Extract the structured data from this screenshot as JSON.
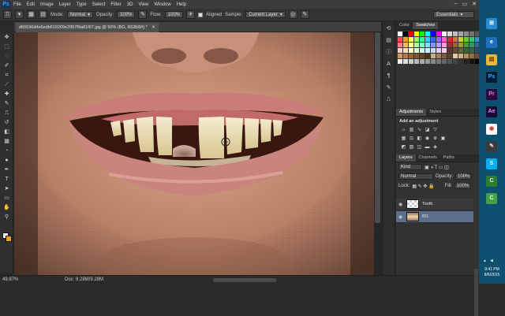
{
  "menubar": {
    "logo": "Ps",
    "items": [
      "File",
      "Edit",
      "Image",
      "Layer",
      "Type",
      "Select",
      "Filter",
      "3D",
      "View",
      "Window",
      "Help"
    ],
    "window_controls": [
      "–",
      "▭",
      "✕"
    ]
  },
  "options": {
    "mode_label": "Mode:",
    "mode_value": "Normal",
    "opacity_label": "Opacity:",
    "opacity_value": "100%",
    "flow_label": "Flow:",
    "flow_value": "100%",
    "aligned_label": "Aligned",
    "sample_label": "Sample:",
    "sample_value": "Current Layer",
    "workspace_value": "Essentials"
  },
  "document": {
    "tab_title": "d65596d4e6edb519209e2957f9a81f67.jpg @ 50% (BG, RGB/8#) *",
    "close": "✕"
  },
  "status": {
    "zoom": "49.87%",
    "doc_info": "Doc: 9.28M/9.28M"
  },
  "panels": {
    "color_tab": "Color",
    "swatches_tab": "Swatches",
    "adjustments_tab": "Adjustments",
    "styles_tab": "Styles",
    "add_adjustment": "Add an adjustment",
    "layers_tab": "Layers",
    "channels_tab": "Channels",
    "paths_tab": "Paths",
    "kind_value": "Kind",
    "blend_value": "Normal",
    "opacity_label": "Opacity:",
    "opacity_value": "100%",
    "lock_label": "Lock:",
    "fill_label": "Fill:",
    "fill_value": "100%",
    "layers": [
      {
        "name": "Tooth"
      },
      {
        "name": "BG"
      }
    ]
  },
  "swatch_colors": [
    "#ffffff",
    "#000000",
    "#ff0000",
    "#ffff00",
    "#00ff00",
    "#00ffff",
    "#0000ff",
    "#ff00ff",
    "#f2f2f2",
    "#d9d9d9",
    "#bfbfbf",
    "#a6a6a6",
    "#8c8c8c",
    "#737373",
    "#595959",
    "#ff4d4d",
    "#ff9933",
    "#ffff66",
    "#99ff66",
    "#33ff99",
    "#33ccff",
    "#3366ff",
    "#9966ff",
    "#ff66cc",
    "#cc3333",
    "#cc7a29",
    "#cccc33",
    "#66cc33",
    "#29cc7a",
    "#2999cc",
    "#ff8080",
    "#ffb366",
    "#ffff99",
    "#b3ff99",
    "#80ffbf",
    "#80dfff",
    "#8099ff",
    "#b399ff",
    "#ff99dd",
    "#993333",
    "#996633",
    "#999933",
    "#4d9933",
    "#339966",
    "#336699",
    "#ffcccc",
    "#ffe0b3",
    "#ffffcc",
    "#d9ffcc",
    "#ccffe6",
    "#ccf2ff",
    "#ccd6ff",
    "#e0ccff",
    "#ffccee",
    "#663333",
    "#664d33",
    "#666633",
    "#336633",
    "#33664d",
    "#334d66",
    "#cc9966",
    "#b37a4d",
    "#996633",
    "#805533",
    "#664422",
    "#4d3319",
    "#c8b08a",
    "#a08060",
    "#7a5c40",
    "#5a4030",
    "#e0c8a0",
    "#d0b080",
    "#b09060",
    "#907040",
    "#705030",
    "#eeeeee",
    "#dddddd",
    "#cccccc",
    "#bbbbbb",
    "#aaaaaa",
    "#999999",
    "#888888",
    "#777777",
    "#666666",
    "#555555",
    "#444444",
    "#333333",
    "#222222",
    "#111111",
    "#000000"
  ],
  "taskbar": {
    "time": "9:41 PM",
    "date": "8/6/2015",
    "apps": [
      {
        "label": "⊞",
        "bg": "#2b8ad6",
        "fg": "#ffffff"
      },
      {
        "label": "e",
        "bg": "#1e6fbf",
        "fg": "#ffffff"
      },
      {
        "label": "▤",
        "bg": "#e8b93a",
        "fg": "#5a3a00"
      },
      {
        "label": "Ps",
        "bg": "#001d34",
        "fg": "#31a8ff"
      },
      {
        "label": "Pr",
        "bg": "#2a0a3a",
        "fg": "#ea77ff"
      },
      {
        "label": "Ae",
        "bg": "#1a0a33",
        "fg": "#d291ff"
      },
      {
        "label": "◉",
        "bg": "#ffffff",
        "fg": "#d93025"
      },
      {
        "label": "✎",
        "bg": "#3a3a3a",
        "fg": "#dddddd"
      },
      {
        "label": "S",
        "bg": "#00aff0",
        "fg": "#ffffff"
      },
      {
        "label": "C",
        "bg": "#2e7d32",
        "fg": "#ffffff"
      },
      {
        "label": "C",
        "bg": "#43a047",
        "fg": "#ffffff"
      }
    ]
  }
}
